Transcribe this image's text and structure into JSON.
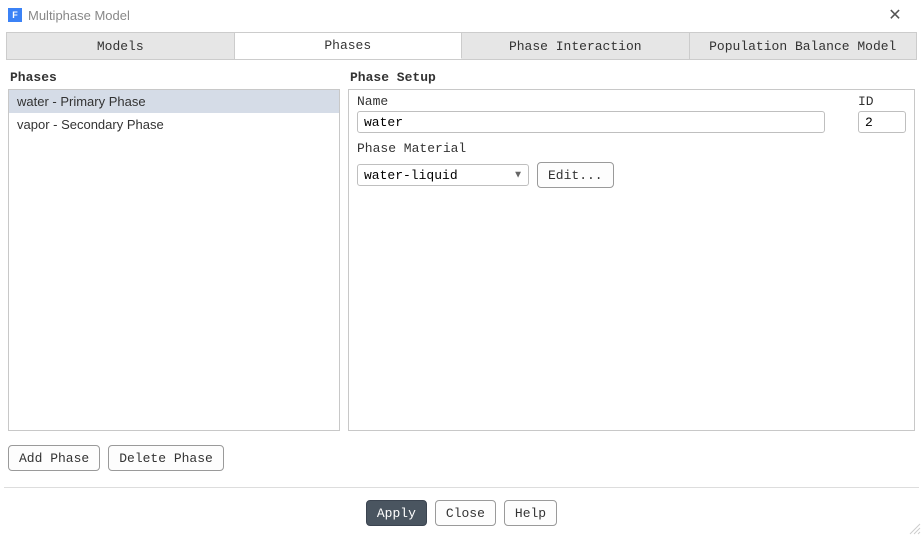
{
  "window": {
    "title": "Multiphase Model",
    "icon_letter": "F"
  },
  "tabs": [
    {
      "label": "Models"
    },
    {
      "label": "Phases"
    },
    {
      "label": "Phase Interaction"
    },
    {
      "label": "Population Balance Model"
    }
  ],
  "active_tab_index": 1,
  "phases_panel": {
    "heading": "Phases",
    "items": [
      "water - Primary Phase",
      "vapor - Secondary Phase"
    ],
    "selected_index": 0,
    "add_label": "Add Phase",
    "delete_label": "Delete Phase"
  },
  "setup_panel": {
    "heading": "Phase Setup",
    "name_label": "Name",
    "name_value": "water",
    "id_label": "ID",
    "id_value": "2",
    "material_label": "Phase Material",
    "material_value": "water-liquid",
    "edit_label": "Edit..."
  },
  "footer": {
    "apply": "Apply",
    "close": "Close",
    "help": "Help"
  }
}
